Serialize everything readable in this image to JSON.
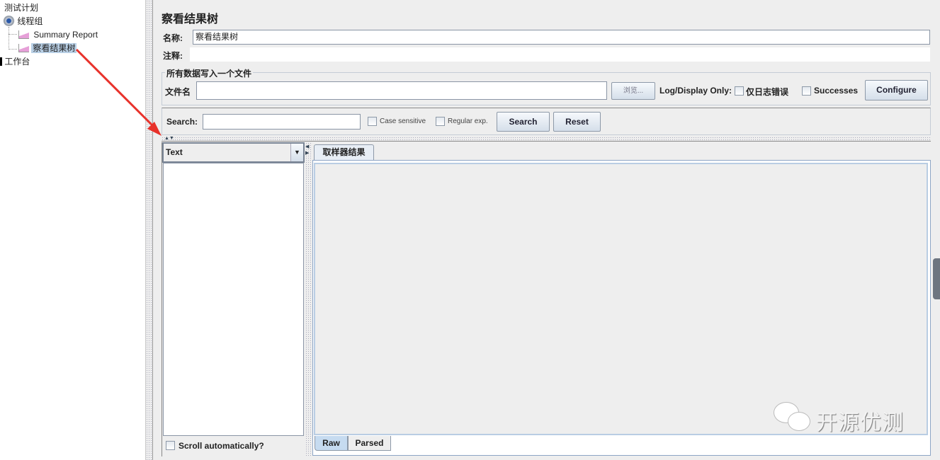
{
  "tree": {
    "items": [
      {
        "label": "测试计划",
        "icon": "test-plan"
      },
      {
        "label": "线程组",
        "icon": "gear-icon"
      },
      {
        "label": "Summary Report",
        "icon": "chart-icon"
      },
      {
        "label": "察看结果树",
        "icon": "chart-icon",
        "selected": true
      },
      {
        "label": "工作台",
        "icon": "workbench"
      }
    ]
  },
  "panel": {
    "title": "察看结果树",
    "name_label": "名称:",
    "name_value": "察看结果树",
    "comment_label": "注释:",
    "comment_value": "",
    "file_group_title": "所有数据写入一个文件",
    "filename_label": "文件名",
    "filename_value": "",
    "browse_label": "浏览...",
    "log_display_label": "Log/Display Only:",
    "errors_label": "仅日志错误",
    "errors_checked": false,
    "successes_label": "Successes",
    "successes_checked": false,
    "configure_label": "Configure"
  },
  "search": {
    "label": "Search:",
    "value": "",
    "case_label": "Case sensitive",
    "case_checked": false,
    "regex_label": "Regular exp.",
    "regex_checked": false,
    "search_button": "Search",
    "reset_button": "Reset"
  },
  "results": {
    "renderer": "Text",
    "scroll_label": "Scroll automatically?",
    "scroll_checked": false,
    "tab": "取样器结果",
    "bottom_tabs": [
      "Raw",
      "Parsed"
    ],
    "active_bottom_tab": "Raw"
  },
  "watermark": "开源优测",
  "colors": {
    "selection": "#b8cfe5",
    "arrow": "#e8312a",
    "tab_active": "#c6dbf0"
  }
}
